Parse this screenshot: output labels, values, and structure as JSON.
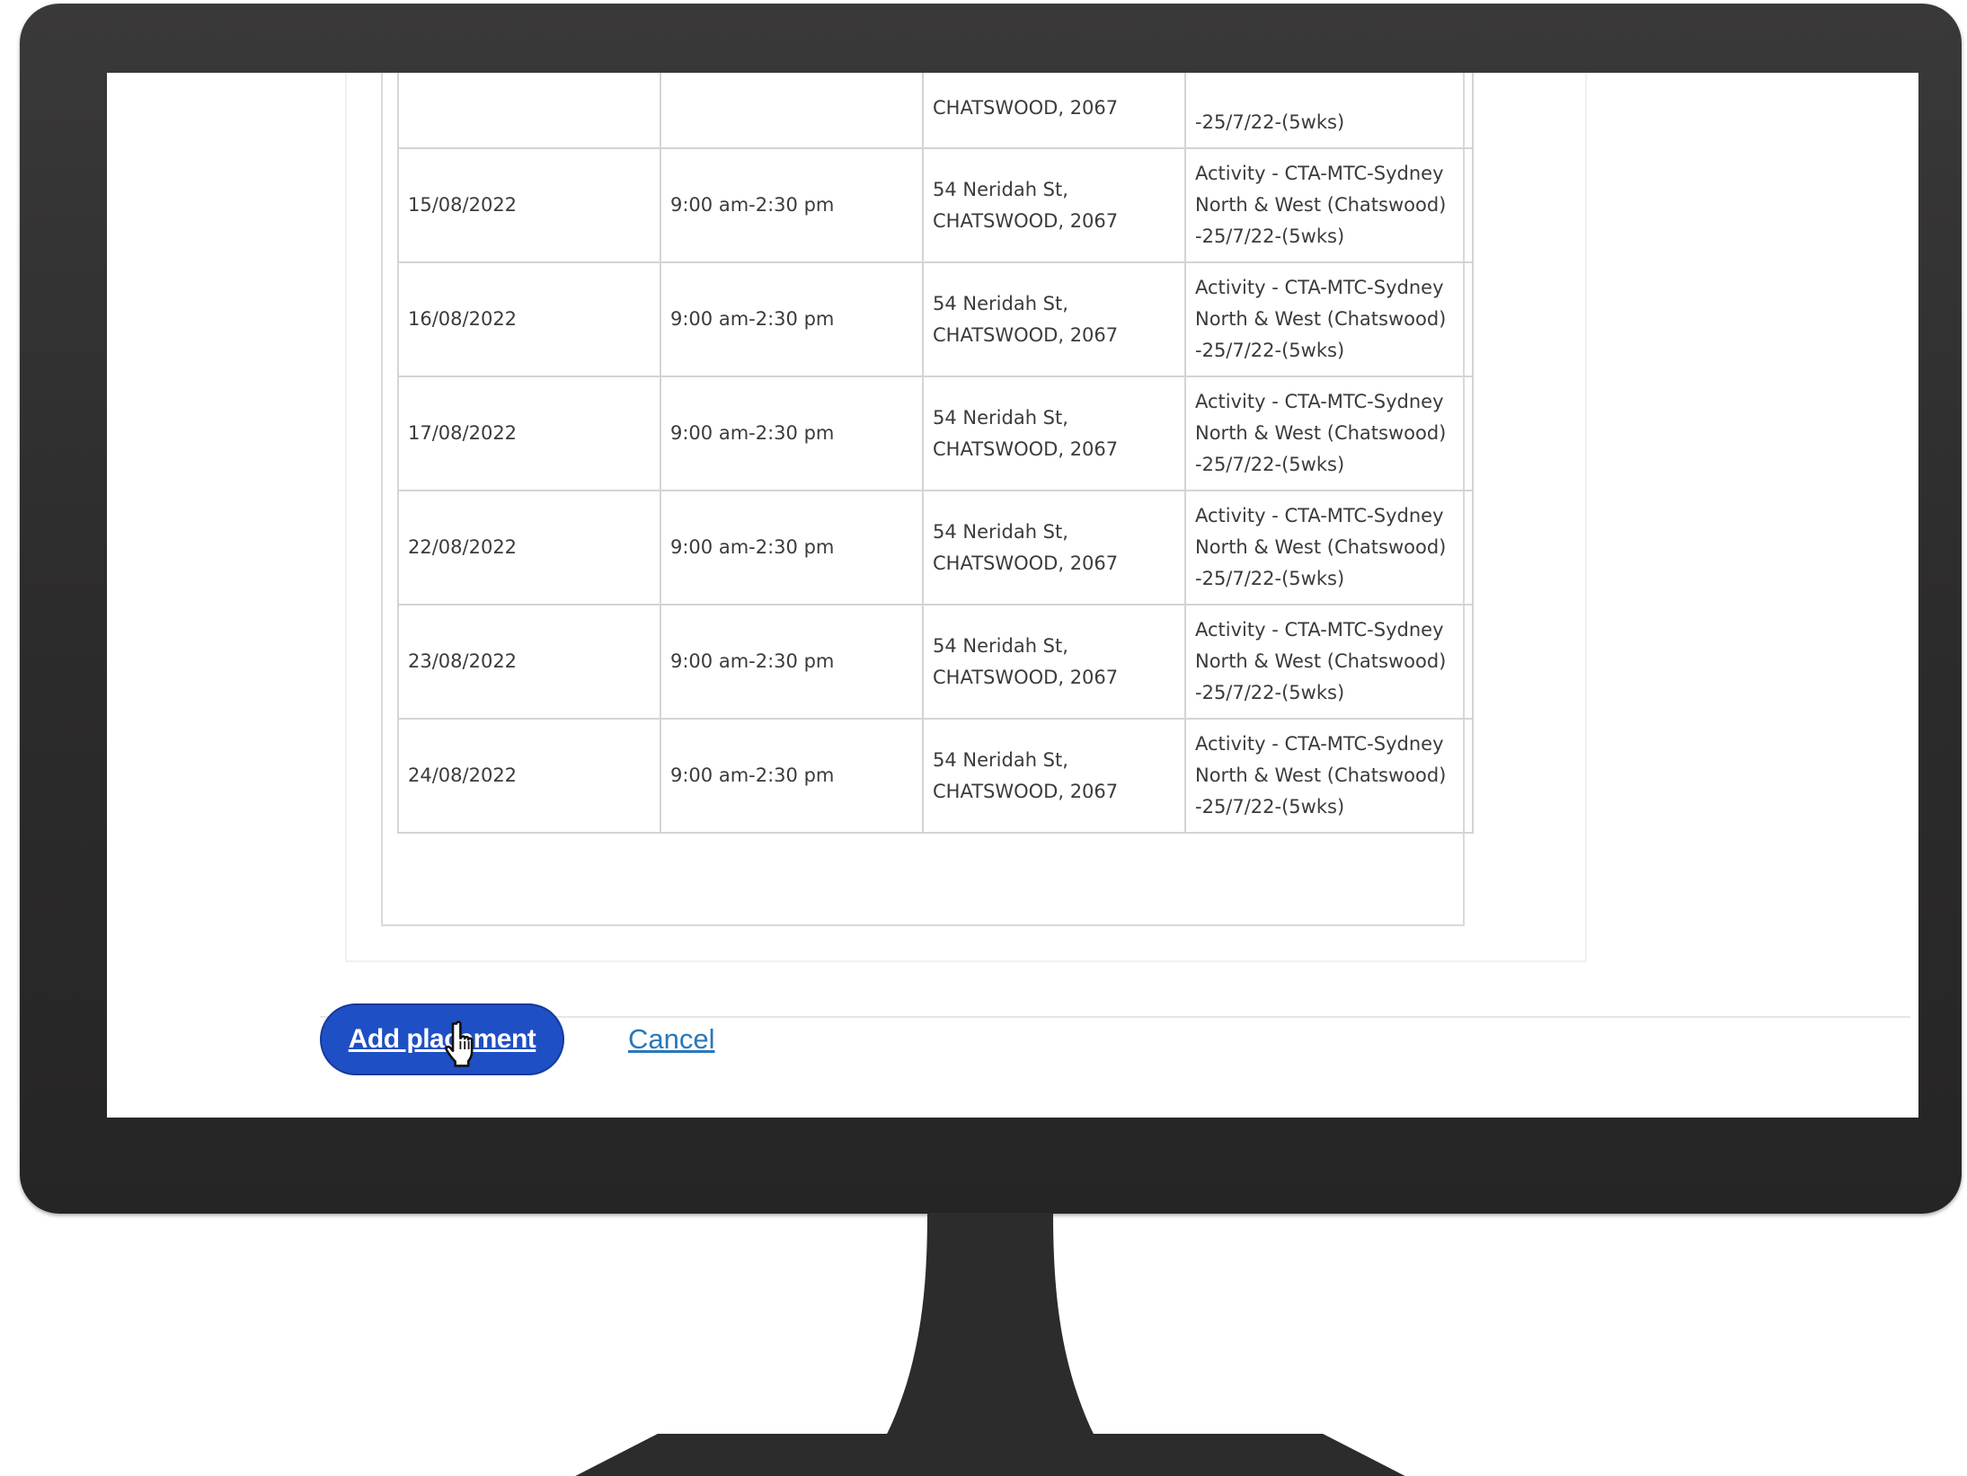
{
  "table": {
    "partial_top_row": {
      "address": "CHATSWOOD, 2067",
      "activity": "-25/7/22-(5wks)"
    },
    "rows": [
      {
        "date": "15/08/2022",
        "time": "9:00 am-2:30 pm",
        "address_line1": "54 Neridah St,",
        "address_line2": "CHATSWOOD, 2067",
        "activity_line1": "Activity - CTA-MTC-Sydney",
        "activity_line2": "North & West (Chatswood)",
        "activity_line3": "-25/7/22-(5wks)"
      },
      {
        "date": "16/08/2022",
        "time": "9:00 am-2:30 pm",
        "address_line1": "54 Neridah St,",
        "address_line2": "CHATSWOOD, 2067",
        "activity_line1": "Activity - CTA-MTC-Sydney",
        "activity_line2": "North & West (Chatswood)",
        "activity_line3": "-25/7/22-(5wks)"
      },
      {
        "date": "17/08/2022",
        "time": "9:00 am-2:30 pm",
        "address_line1": "54 Neridah St,",
        "address_line2": "CHATSWOOD, 2067",
        "activity_line1": "Activity - CTA-MTC-Sydney",
        "activity_line2": "North & West (Chatswood)",
        "activity_line3": "-25/7/22-(5wks)"
      },
      {
        "date": "22/08/2022",
        "time": "9:00 am-2:30 pm",
        "address_line1": "54 Neridah St,",
        "address_line2": "CHATSWOOD, 2067",
        "activity_line1": "Activity - CTA-MTC-Sydney",
        "activity_line2": "North & West (Chatswood)",
        "activity_line3": "-25/7/22-(5wks)"
      },
      {
        "date": "23/08/2022",
        "time": "9:00 am-2:30 pm",
        "address_line1": "54 Neridah St,",
        "address_line2": "CHATSWOOD, 2067",
        "activity_line1": "Activity - CTA-MTC-Sydney",
        "activity_line2": "North & West (Chatswood)",
        "activity_line3": "-25/7/22-(5wks)"
      },
      {
        "date": "24/08/2022",
        "time": "9:00 am-2:30 pm",
        "address_line1": "54 Neridah St,",
        "address_line2": "CHATSWOOD, 2067",
        "activity_line1": "Activity - CTA-MTC-Sydney",
        "activity_line2": "North & West (Chatswood)",
        "activity_line3": "-25/7/22-(5wks)"
      }
    ]
  },
  "actions": {
    "primary_label": "Add placement",
    "cancel_label": "Cancel"
  },
  "cursor_icon": "hand-pointer-icon",
  "colors": {
    "primary_button": "#1f4fc4",
    "link": "#2a78b8",
    "bezel": "#2d2c2c"
  }
}
